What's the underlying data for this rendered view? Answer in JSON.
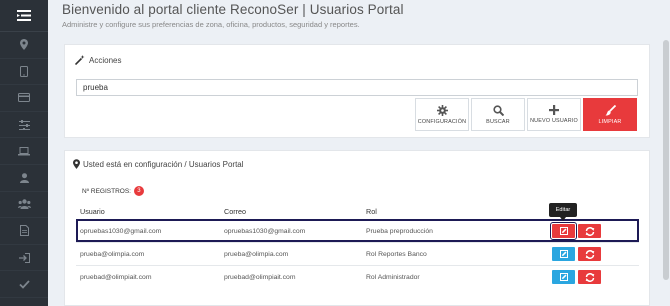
{
  "header": {
    "title": "Bienvenido al portal cliente ReconoSer | Usuarios Portal",
    "subtitle": "Administre y configure sus preferencias de zona, oficina, productos, seguridad y reportes."
  },
  "sidebar": {
    "toggle_icon": "menu-icon",
    "items": [
      {
        "icon": "map-marker-icon"
      },
      {
        "icon": "tablet-icon"
      },
      {
        "icon": "credit-card-icon"
      },
      {
        "icon": "sliders-icon"
      },
      {
        "icon": "laptop-icon"
      },
      {
        "icon": "user-icon"
      },
      {
        "icon": "users-icon"
      },
      {
        "icon": "file-icon"
      },
      {
        "icon": "sign-in-icon"
      },
      {
        "icon": "check-icon"
      }
    ]
  },
  "acciones": {
    "title": "Acciones",
    "search_value": "prueba",
    "buttons": {
      "config": "CONFIGURACIÓN",
      "search": "BUSCAR",
      "new_user": "NUEVO USUARIO",
      "clear": "LIMPIAR"
    }
  },
  "tabla": {
    "breadcrumb": "Usted está en configuración / Usuarios Portal",
    "count_label": "Nº REGISTROS:",
    "count": "3",
    "columns": {
      "usuario": "Usuario",
      "correo": "Correo",
      "rol": "Rol"
    },
    "rows": [
      {
        "usuario": "opruebas1030@gmail.com",
        "correo": "opruebas1030@gmail.com",
        "rol": "Prueba preproducción"
      },
      {
        "usuario": "prueba@olimpia.com",
        "correo": "prueba@olimpia.com",
        "rol": "Rol Reportes Banco"
      },
      {
        "usuario": "pruebad@olimpiait.com",
        "correo": "pruebad@olimpiait.com",
        "rol": "Rol Administrador"
      }
    ],
    "tooltip": "Editar"
  },
  "colors": {
    "accent_red": "#e83a3c",
    "edit_blue": "#2aa6e0",
    "sidebar_bg": "#2b3138"
  }
}
